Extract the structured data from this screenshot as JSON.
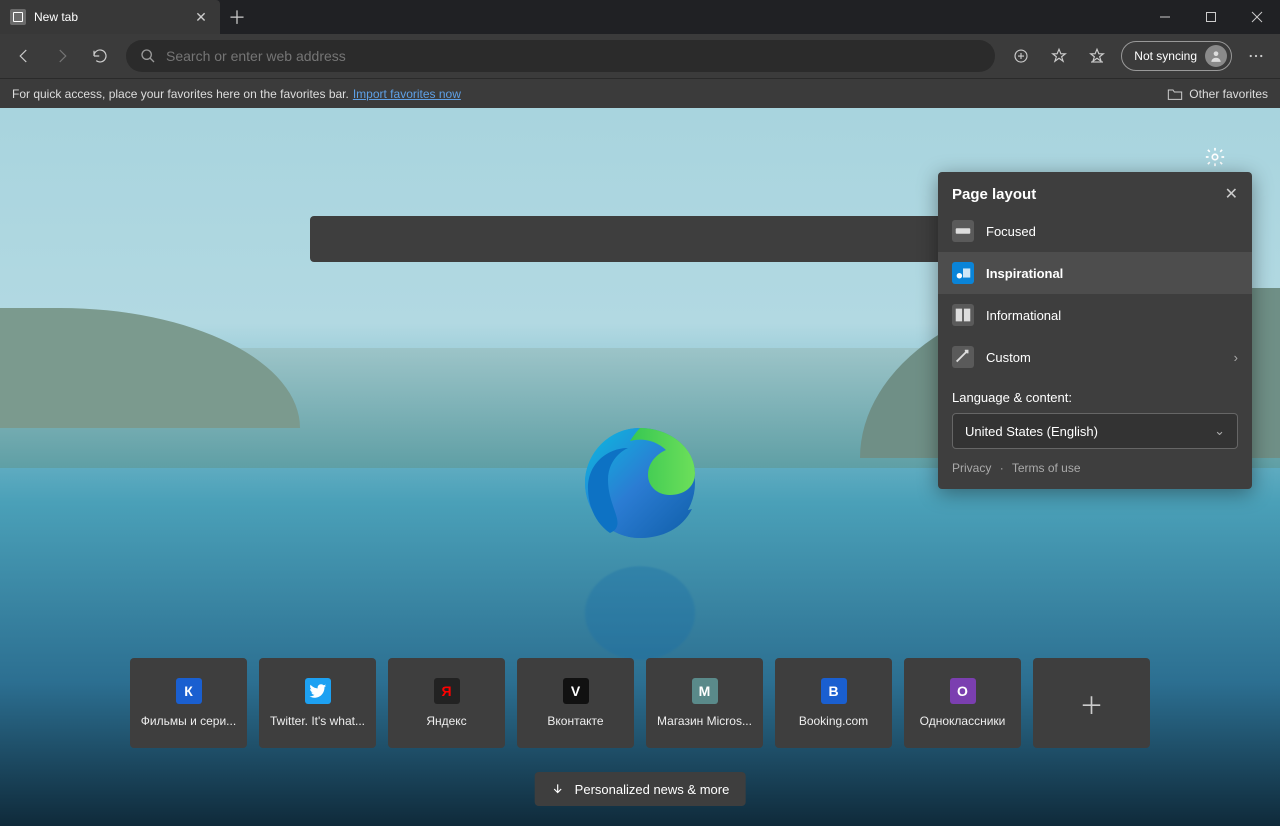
{
  "tab": {
    "title": "New tab"
  },
  "address_bar": {
    "placeholder": "Search or enter web address"
  },
  "sync": {
    "label": "Not syncing"
  },
  "favorites_bar": {
    "hint": "For quick access, place your favorites here on the favorites bar.",
    "import_link": "Import favorites now",
    "other": "Other favorites"
  },
  "settings_panel": {
    "title": "Page layout",
    "options": [
      {
        "label": "Focused"
      },
      {
        "label": "Inspirational",
        "selected": true
      },
      {
        "label": "Informational"
      },
      {
        "label": "Custom",
        "chevron": true
      }
    ],
    "language_heading": "Language & content:",
    "language_value": "United States (English)",
    "privacy": "Privacy",
    "terms": "Terms of use"
  },
  "tiles": [
    {
      "letter": "К",
      "label": "Фильмы и сери...",
      "bg": "#1a5fd0"
    },
    {
      "letter": "",
      "label": "Twitter. It's what...",
      "bg": "#1da1f2",
      "twitter": true
    },
    {
      "letter": "Я",
      "label": "Яндекс",
      "bg": "#222",
      "fg": "#ff0000"
    },
    {
      "letter": "V",
      "label": "Вконтакте",
      "bg": "#111"
    },
    {
      "letter": "M",
      "label": "Магазин Micros...",
      "bg": "#5a8a8a"
    },
    {
      "letter": "B",
      "label": "Booking.com",
      "bg": "#1a5fd0"
    },
    {
      "letter": "O",
      "label": "Одноклассники",
      "bg": "#7b3fb0"
    }
  ],
  "news_button": "Personalized news & more"
}
